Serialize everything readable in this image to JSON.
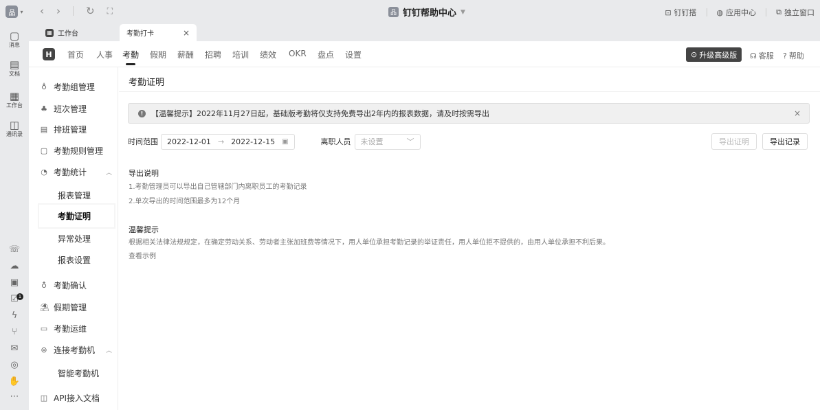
{
  "titlebar": {
    "window_title": "钉钉帮助中心",
    "right": [
      "钉钉搭",
      "应用中心",
      "独立窗口"
    ]
  },
  "rail": {
    "items": [
      {
        "label": "消息"
      },
      {
        "label": "文档"
      },
      {
        "label": "工作台"
      },
      {
        "label": "通讯录"
      }
    ],
    "badge_count": "1"
  },
  "tabs": {
    "home": "工作台",
    "active": "考勤打卡"
  },
  "topnav": {
    "items": [
      "首页",
      "人事",
      "考勤",
      "假期",
      "薪酬",
      "招聘",
      "培训",
      "绩效",
      "OKR",
      "盘点",
      "设置"
    ],
    "upgrade": "升级高级版",
    "service": "客服",
    "help": "帮助"
  },
  "sidebar": {
    "items": [
      "考勤组管理",
      "班次管理",
      "排班管理",
      "考勤规则管理",
      "考勤统计",
      "考勤确认",
      "假期管理",
      "考勤运维",
      "连接考勤机",
      "API接入文档"
    ],
    "stats_sub": [
      "报表管理",
      "考勤证明",
      "异常处理",
      "报表设置"
    ],
    "machine_sub": [
      "智能考勤机"
    ]
  },
  "main": {
    "title": "考勤证明",
    "alert": "【温馨提示】2022年11月27日起，基础版考勤将仅支持免费导出2年内的报表数据，请及时按需导出",
    "filters": {
      "range_label": "时间范围",
      "start_date": "2022-12-01",
      "end_date": "2022-12-15",
      "resigned_label": "离职人员",
      "resigned_placeholder": "未设置"
    },
    "buttons": {
      "export_proof": "导出证明",
      "export_records": "导出记录"
    },
    "export_notes": {
      "title": "导出说明",
      "lines": [
        "1.考勤管理员可以导出自己管辖部门内离职员工的考勤记录",
        "2.单次导出的时间范围最多为12个月"
      ]
    },
    "tips": {
      "title": "温馨提示",
      "text": "根据相关法律法规规定，在确定劳动关系、劳动者主张加班费等情况下，用人单位承担考勤记录的举证责任，用人单位拒不提供的，由用人单位承担不利后果。",
      "link": "查看示例"
    }
  }
}
